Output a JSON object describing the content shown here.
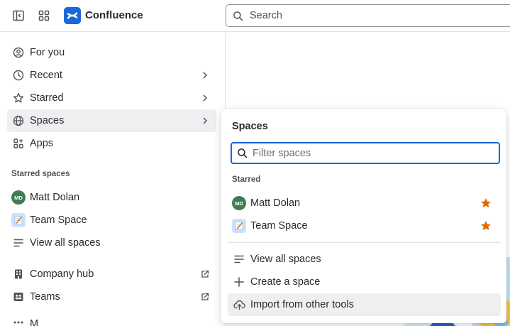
{
  "topbar": {
    "app_name": "Confluence",
    "search_placeholder": "Search"
  },
  "sidebar": {
    "items": [
      {
        "label": "For you",
        "icon": "person-circle-icon"
      },
      {
        "label": "Recent",
        "icon": "clock-icon"
      },
      {
        "label": "Starred",
        "icon": "star-icon"
      },
      {
        "label": "Spaces",
        "icon": "globe-icon"
      },
      {
        "label": "Apps",
        "icon": "apps-icon"
      }
    ],
    "starred_title": "Starred spaces",
    "starred": [
      {
        "label": "Matt Dolan",
        "avatar": "MD"
      },
      {
        "label": "Team Space"
      },
      {
        "label": "View all spaces"
      }
    ],
    "more": [
      {
        "label": "Company hub"
      },
      {
        "label": "Teams"
      }
    ],
    "cut_off_label": "M"
  },
  "popup": {
    "title": "Spaces",
    "filter_placeholder": "Filter spaces",
    "starred_title": "Starred",
    "starred": [
      {
        "label": "Matt Dolan",
        "avatar": "MD"
      },
      {
        "label": "Team Space"
      }
    ],
    "actions": [
      {
        "label": "View all spaces"
      },
      {
        "label": "Create a space"
      },
      {
        "label": "Import from other tools"
      }
    ]
  },
  "colors": {
    "brand": "#1868DB",
    "avatar_green": "#3E7D52",
    "star_orange": "#E06C00",
    "hover_bg": "#EEEFF1"
  }
}
